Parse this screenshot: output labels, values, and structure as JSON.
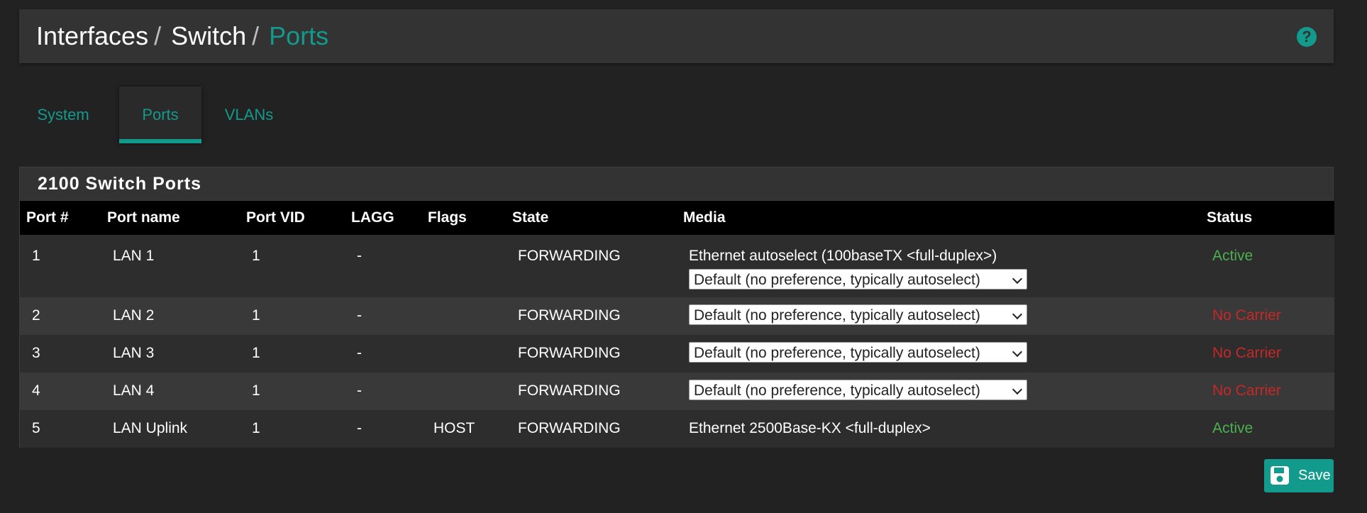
{
  "header": {
    "breadcrumb": [
      "Interfaces",
      "Switch",
      "Ports"
    ],
    "separator": "/",
    "help_glyph": "?",
    "help_icon": "question-circle-icon"
  },
  "tabs": [
    {
      "label": "System",
      "active": false
    },
    {
      "label": "Ports",
      "active": true
    },
    {
      "label": "VLANs",
      "active": false
    }
  ],
  "panel": {
    "title": "2100 Switch Ports",
    "columns": [
      "Port #",
      "Port name",
      "Port VID",
      "LAGG",
      "Flags",
      "State",
      "Media",
      "Status"
    ],
    "rows": [
      {
        "port": "1",
        "name": "LAN 1",
        "vid": "1",
        "lagg": "-",
        "flags": "",
        "state": "FORWARDING",
        "media_text": "Ethernet autoselect (100baseTX <full-duplex>)",
        "media_select": "Default (no preference, typically autoselect)",
        "status": "Active"
      },
      {
        "port": "2",
        "name": "LAN 2",
        "vid": "1",
        "lagg": "-",
        "flags": "",
        "state": "FORWARDING",
        "media_text": "",
        "media_select": "Default (no preference, typically autoselect)",
        "status": "No Carrier"
      },
      {
        "port": "3",
        "name": "LAN 3",
        "vid": "1",
        "lagg": "-",
        "flags": "",
        "state": "FORWARDING",
        "media_text": "",
        "media_select": "Default (no preference, typically autoselect)",
        "status": "No Carrier"
      },
      {
        "port": "4",
        "name": "LAN 4",
        "vid": "1",
        "lagg": "-",
        "flags": "",
        "state": "FORWARDING",
        "media_text": "",
        "media_select": "Default (no preference, typically autoselect)",
        "status": "No Carrier"
      },
      {
        "port": "5",
        "name": "LAN Uplink",
        "vid": "1",
        "lagg": "-",
        "flags": "HOST",
        "state": "FORWARDING",
        "media_text": "Ethernet 2500Base-KX <full-duplex>",
        "media_select": "",
        "status": "Active"
      }
    ]
  },
  "save": {
    "label": "Save",
    "icon": "floppy-disk-icon"
  },
  "colors": {
    "accent": "#129a8c",
    "active": "#4caf50",
    "no_carrier": "#c62828",
    "background": "#222222"
  }
}
